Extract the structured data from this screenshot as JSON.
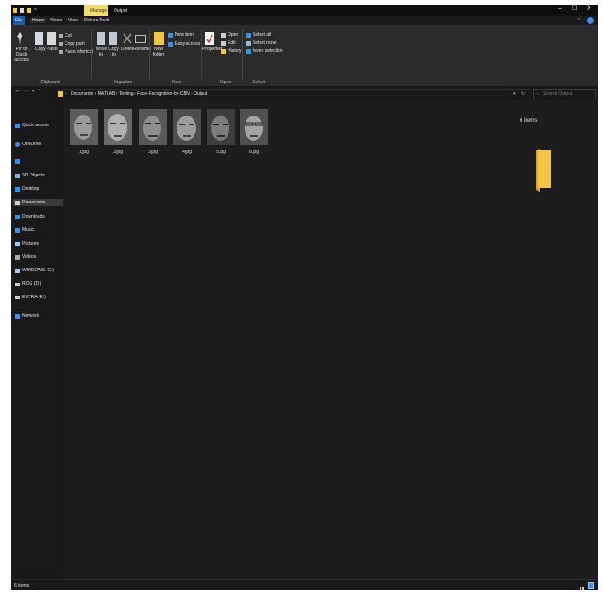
{
  "window": {
    "context_tab": "Manage",
    "title": "Output",
    "controls": [
      "–",
      "☐",
      "X"
    ]
  },
  "tabs": [
    "File",
    "Home",
    "Share",
    "View",
    "Picture Tools"
  ],
  "ribbon": {
    "clipboard": {
      "pin_label": "Pin to Quick access",
      "copy_label": "Copy",
      "paste_label": "Paste",
      "cut_label": "Cut",
      "copy_path_label": "Copy path",
      "paste_shortcut_label": "Paste shortcut",
      "group_label": "Clipboard"
    },
    "organize": {
      "move_to_label": "Move to",
      "copy_to_label": "Copy to",
      "delete_label": "Delete",
      "rename_label": "Rename",
      "group_label": "Organize"
    },
    "new": {
      "new_folder_label": "New folder",
      "new_item_label": "New item",
      "easy_access_label": "Easy access",
      "group_label": "New"
    },
    "open": {
      "properties_label": "Properties",
      "open_label": "Open",
      "edit_label": "Edit",
      "history_label": "History",
      "group_label": "Open"
    },
    "select": {
      "select_all_label": "Select all",
      "select_none_label": "Select none",
      "invert_label": "Invert selection",
      "group_label": "Select"
    }
  },
  "address": {
    "path": [
      "Documents",
      "MATLAB",
      "Testing",
      "Face-Recognition-by-CNN",
      "Output"
    ],
    "search_placeholder": "Search Output"
  },
  "nav": {
    "items": [
      {
        "label": "Quick access",
        "icon": "star-icon",
        "color": "#3b8eea"
      },
      {
        "label": "OneDrive",
        "icon": "cloud-icon",
        "color": "#3b8eea"
      },
      {
        "label": "This PC",
        "icon": "pc-icon",
        "color": "#3b8eea"
      },
      {
        "label": "3D Objects",
        "icon": "cube-icon",
        "color": "#6fb4f0"
      },
      {
        "label": "Desktop",
        "icon": "desktop-icon",
        "color": "#3b8eea"
      },
      {
        "label": "Documents",
        "icon": "document-icon",
        "color": "#cfcfcf"
      },
      {
        "label": "Downloads",
        "icon": "download-icon",
        "color": "#3b8eea"
      },
      {
        "label": "Music",
        "icon": "music-icon",
        "color": "#3b8eea"
      },
      {
        "label": "Pictures",
        "icon": "pictures-icon",
        "color": "#9ec9f5"
      },
      {
        "label": "Videos",
        "icon": "video-icon",
        "color": "#aaaaaa"
      },
      {
        "label": "WINDOWS (C:)",
        "icon": "drive-icon",
        "color": "#9ec9f5"
      },
      {
        "label": "ROG (D:)",
        "icon": "drive-icon",
        "color": "#cccccc"
      },
      {
        "label": "EXTRA (E:)",
        "icon": "drive-icon",
        "color": "#cccccc"
      },
      {
        "label": "Network",
        "icon": "network-icon",
        "color": "#3b8eea"
      }
    ]
  },
  "files": [
    "1.jpg",
    "2.jpg",
    "3.jpg",
    "4.jpg",
    "5.jpg",
    "6.jpg"
  ],
  "preview": {
    "items_label": "6 items"
  },
  "status": {
    "count": "6 items"
  },
  "colors": {
    "accent": "#1e5fa8",
    "context_tab": "#f2dc6e",
    "folder": "#f4c542"
  }
}
